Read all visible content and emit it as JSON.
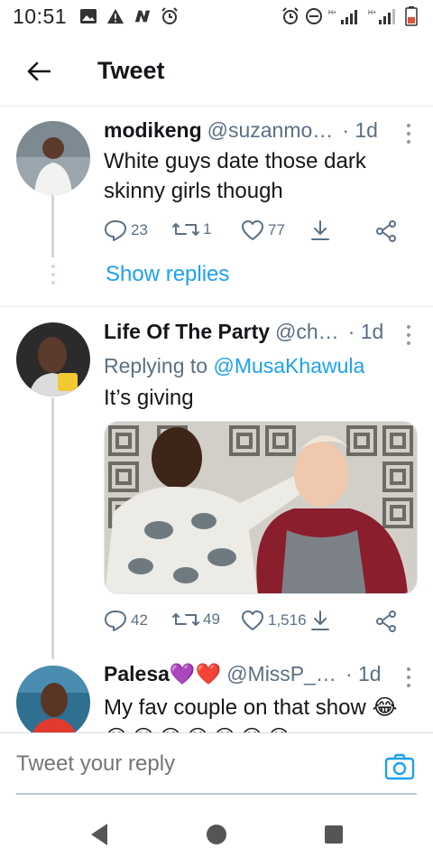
{
  "status_bar": {
    "time": "10:51"
  },
  "header": {
    "title": "Tweet"
  },
  "tweets": [
    {
      "name": "modikeng",
      "handle": "@suzanmo…",
      "time": "· 1d",
      "text": "White guys date those dark skinny girls though",
      "replies": "23",
      "retweets": "1",
      "likes": "77",
      "show_replies": "Show replies"
    },
    {
      "name": "Life Of The Party",
      "handle": "@ch…",
      "time": "· 1d",
      "reply_prefix": "Replying to",
      "reply_mention": "@MusaKhawula",
      "text": "It’s giving",
      "replies": "42",
      "retweets": "49",
      "likes": "1,516"
    },
    {
      "name": "Palesa💜❤️",
      "handle": "@MissP_…",
      "time": "· 1d",
      "text": "My fav couple on that show 😂",
      "emoji_row": "😂😂😂😂😂😂😂"
    }
  ],
  "reply_bar": {
    "placeholder": "Tweet your reply"
  },
  "colors": {
    "accent": "#1da1f2",
    "secondary_text": "#5b7083",
    "divider": "#e6ecf0"
  }
}
